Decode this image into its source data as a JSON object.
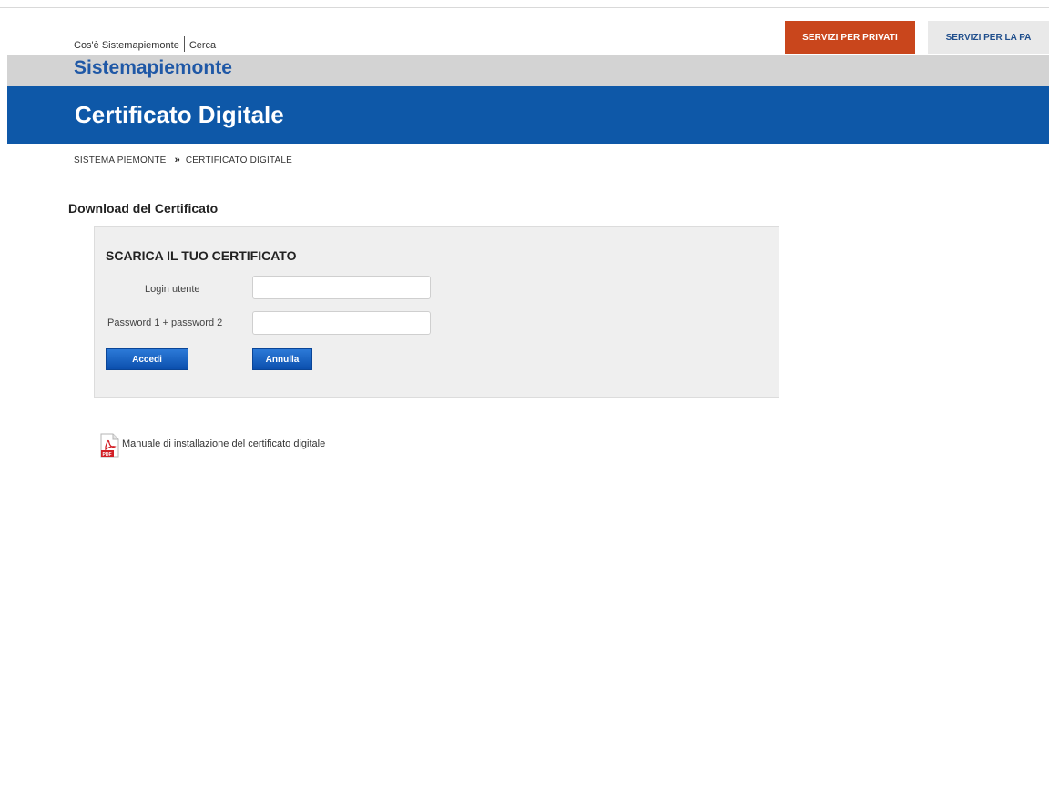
{
  "top_links": {
    "about": "Cos'è Sistemapiemonte",
    "search": "Cerca"
  },
  "top_buttons": {
    "privati": "SERVIZI PER PRIVATI",
    "pa": "SERVIZI PER LA PA"
  },
  "colors": {
    "privati_bg": "#c9461c",
    "title_bar": "#0e58a8",
    "brand_text": "#1f58a6",
    "button": "#0c4fad"
  },
  "brand": "Sistemapiemonte",
  "page_title": "Certificato Digitale",
  "breadcrumb": {
    "home": "SISTEMA PIEMONTE",
    "separator": "»",
    "current": "CERTIFICATO DIGITALE"
  },
  "section_title": "Download del Certificato",
  "form": {
    "title": "SCARICA IL TUO CERTIFICATO",
    "login_label": "Login utente",
    "login_value": "",
    "password_label": "Password 1 + password 2",
    "password_value": "",
    "submit_label": "Accedi",
    "cancel_label": "Annulla"
  },
  "manual": {
    "icon": "pdf-icon",
    "link_text": "Manuale di installazione del certificato digitale"
  }
}
